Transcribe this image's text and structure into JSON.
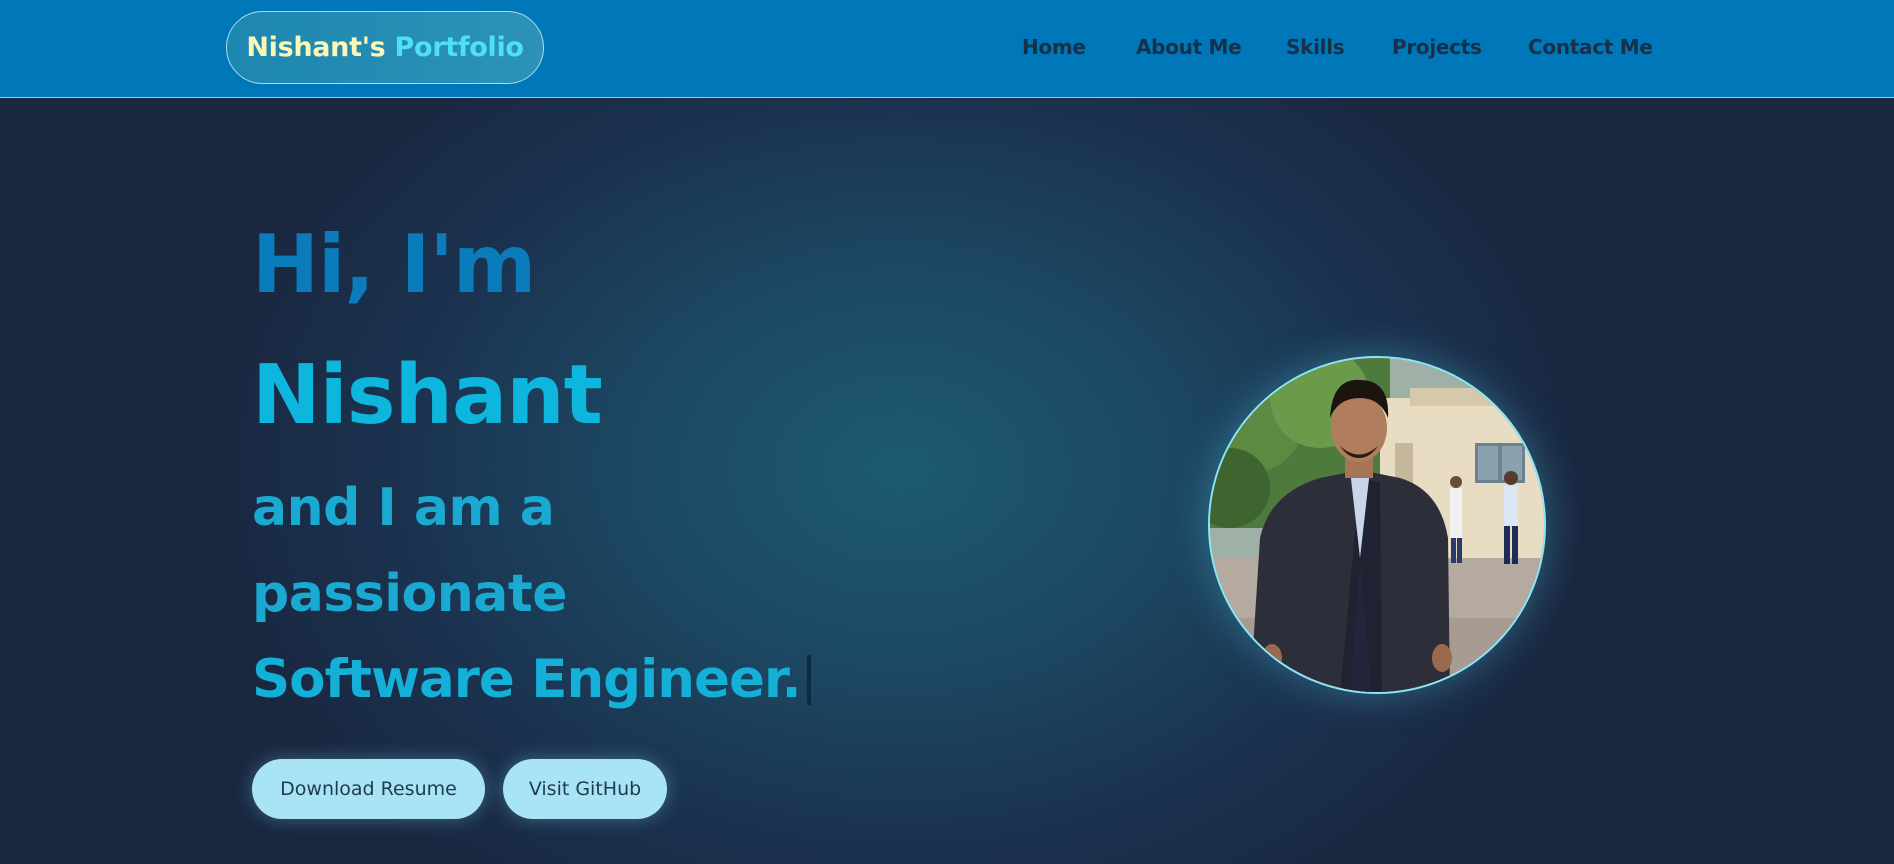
{
  "navbar": {
    "brand": {
      "name": "Nishant's",
      "accent": "Portfolio"
    },
    "links": [
      {
        "label": "Home"
      },
      {
        "label": "About Me"
      },
      {
        "label": "Skills"
      },
      {
        "label": "Projects"
      },
      {
        "label": "Contact Me"
      }
    ]
  },
  "hero": {
    "greeting": "Hi, I'm",
    "name": "Nishant",
    "intro_line1": "and I am a",
    "intro_line2": "passionate",
    "role": "Software Engineer.",
    "buttons": {
      "resume": "Download Resume",
      "github": "Visit GitHub"
    },
    "photo_icon": "profile-photo"
  },
  "colors": {
    "navbar_bg": "#0077b8",
    "hero_bg": "#1a2740",
    "accent_cyan": "#0cb6dc",
    "greeting_blue": "#0a7bbb",
    "button_bg": "#a9e4f4"
  }
}
